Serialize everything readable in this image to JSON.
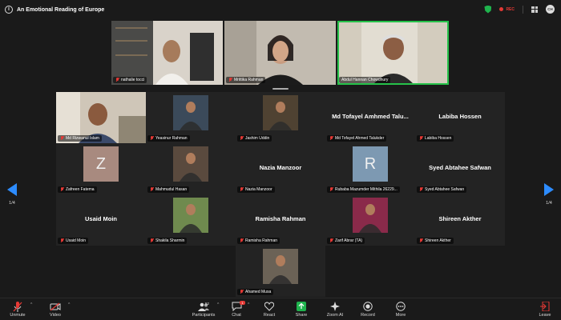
{
  "meeting": {
    "title": "An Emotional Reading of Europe",
    "rec_label": "REC",
    "user_initials": "CH"
  },
  "top_strip": [
    {
      "name": "nathalie tocci",
      "bg": "#cfc8bd"
    },
    {
      "name": "Mrittika Rahman",
      "bg": "#b9b2a6"
    },
    {
      "name": "Abdul Hannan Chowdhury",
      "bg": "#cac2b4"
    }
  ],
  "gallery": [
    {
      "name": "Md Rizwanul Islam",
      "kind": "video",
      "bg": "#9a8f84"
    },
    {
      "name": "Yeasinur Rahman",
      "kind": "photo",
      "bg": "#3b4a5a"
    },
    {
      "name": "Jashim Uddin",
      "kind": "photo",
      "bg": "#4f4232"
    },
    {
      "name": "Md Tofayel Ahmed Talukder",
      "display": "Md Tofayel Amhmed Talu...",
      "kind": "text"
    },
    {
      "name": "Labiba Hossen",
      "display": "Labiba Hossen",
      "kind": "text"
    },
    {
      "name": "Zafreen Fatema",
      "kind": "letter",
      "letter": "Z",
      "bg": "#a88a7f"
    },
    {
      "name": "Mahmudul Hasan",
      "kind": "photo",
      "bg": "#5a4a3e"
    },
    {
      "name": "Nazia Manzoor",
      "display": "Nazia Manzoor",
      "kind": "text"
    },
    {
      "name": "Rubaba Mazumder Mithila 26229...",
      "kind": "letter",
      "letter": "R",
      "bg": "#7d99b2"
    },
    {
      "name": "Syed Abtahee Safwan",
      "display": "Syed Abtahee Safwan",
      "kind": "text"
    },
    {
      "name": "Usaid Moin",
      "display": "Usaid Moin",
      "kind": "text"
    },
    {
      "name": "Shakila Sharmin",
      "kind": "photo",
      "bg": "#6f8a4e"
    },
    {
      "name": "Ramisha Rahman",
      "display": "Ramisha Rahman",
      "kind": "text"
    },
    {
      "name": "Zarif Abrar (TA)",
      "kind": "photo",
      "bg": "#8a2a4a"
    },
    {
      "name": "Shireen Akther",
      "display": "Shireen Akther",
      "kind": "text"
    },
    {
      "name": "Ahamed Musa",
      "kind": "photo",
      "bg": "#6b6256"
    }
  ],
  "pager": {
    "left": "1/4",
    "right": "1/4"
  },
  "toolbar": {
    "unmute": "Unmute",
    "video": "Video",
    "participants": "Participants",
    "participants_count": "52",
    "chat": "Chat",
    "chat_badge": "1",
    "react": "React",
    "share": "Share",
    "zoom_ai": "Zoom AI",
    "record": "Record",
    "more": "More",
    "leave": "Leave"
  },
  "colors": {
    "accent": "#2d8cff",
    "active_speaker": "#26c24a",
    "share_green": "#1fb34d",
    "danger": "#e53935"
  }
}
